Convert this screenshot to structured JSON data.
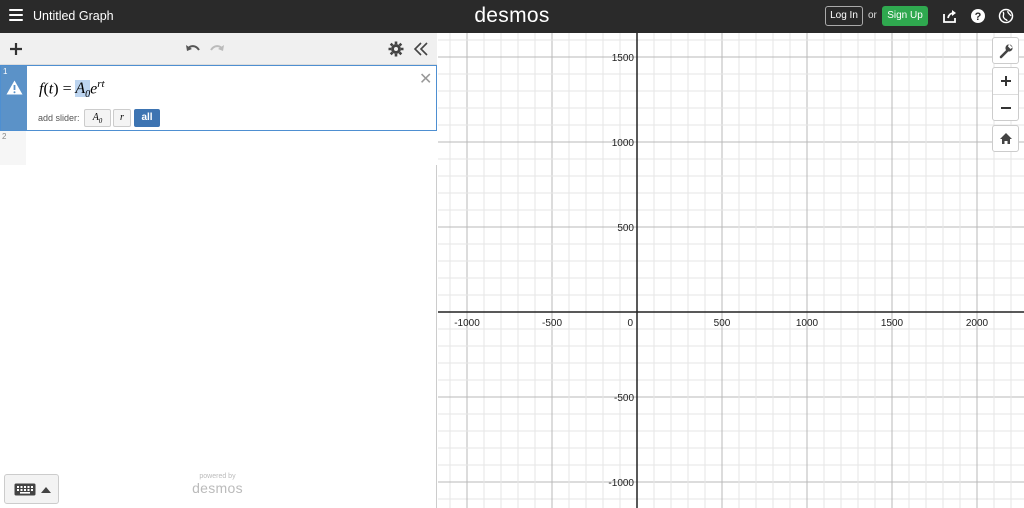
{
  "header": {
    "title": "Untitled Graph",
    "logo": "desmos",
    "login_label": "Log In",
    "or_label": "or",
    "signup_label": "Sign Up"
  },
  "expressions": [
    {
      "index": "1",
      "formula": {
        "func": "f",
        "var": "t",
        "coef": "A",
        "coef_sub": "0",
        "base": "e",
        "exponent": "rt"
      },
      "add_slider_label": "add slider:",
      "slider_buttons": {
        "a0": "A",
        "a0_sub": "0",
        "r": "r",
        "all": "all"
      },
      "status_icon": "warning-icon"
    },
    {
      "index": "2"
    }
  ],
  "footer": {
    "powered_by": "powered by",
    "powered_logo": "desmos"
  },
  "graph": {
    "x_ticks": [
      "-1000",
      "-500",
      "0",
      "500",
      "1000",
      "1500",
      "2000"
    ],
    "y_ticks": [
      "1500",
      "1000",
      "500",
      "-500",
      "-1000"
    ]
  },
  "colors": {
    "header_bg": "#2a2a2a",
    "signup_green": "#2fa84f",
    "expression_active_blue": "#5b92c8",
    "all_button_blue": "#3d74b2"
  }
}
